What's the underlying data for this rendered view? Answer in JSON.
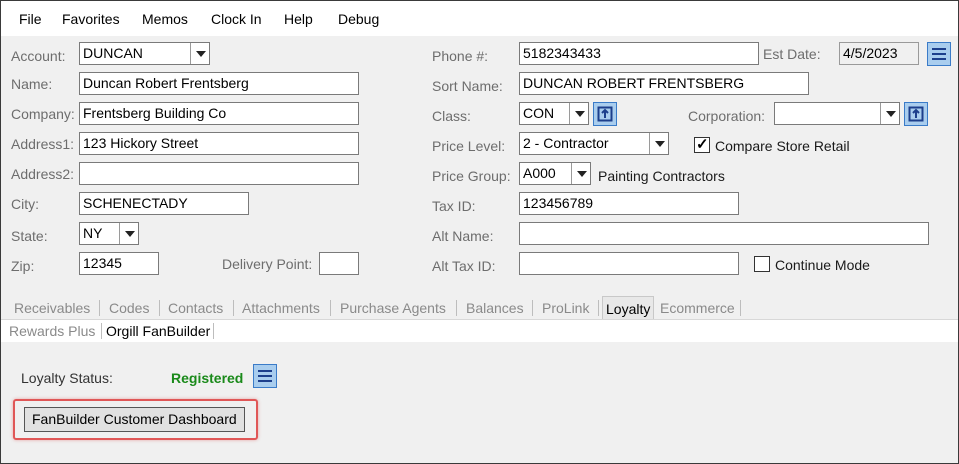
{
  "menu": [
    "File",
    "Favorites",
    "Memos",
    "Clock In",
    "Help",
    "Debug"
  ],
  "left": {
    "account_label": "Account:",
    "account_value": "DUNCAN",
    "name_label": "Name:",
    "name_value": "Duncan Robert Frentsberg",
    "company_label": "Company:",
    "company_value": "Frentsberg Building Co",
    "address1_label": "Address1:",
    "address1_value": "123 Hickory Street",
    "address2_label": "Address2:",
    "address2_value": "",
    "city_label": "City:",
    "city_value": "SCHENECTADY",
    "state_label": "State:",
    "state_value": "NY",
    "zip_label": "Zip:",
    "zip_value": "12345",
    "delivery_label": "Delivery Point:",
    "delivery_value": ""
  },
  "right": {
    "phone_label": "Phone #:",
    "phone_value": "5182343433",
    "estdate_label": "Est Date:",
    "estdate_value": "4/5/2023",
    "sortname_label": "Sort Name:",
    "sortname_value": "DUNCAN ROBERT FRENTSBERG",
    "class_label": "Class:",
    "class_value": "CON",
    "corporation_label": "Corporation:",
    "corporation_value": "",
    "pricelevel_label": "Price Level:",
    "pricelevel_value": "2 - Contractor",
    "compare_label": "Compare Store Retail",
    "compare_checked": true,
    "pricegroup_label": "Price Group:",
    "pricegroup_value": "A000",
    "pricegroup_desc": "Painting Contractors",
    "taxid_label": "Tax ID:",
    "taxid_value": "123456789",
    "altname_label": "Alt  Name:",
    "altname_value": "",
    "alttaxid_label": "Alt Tax ID:",
    "alttaxid_value": "",
    "continue_label": "Continue Mode",
    "continue_checked": false
  },
  "tabs": [
    "Receivables",
    "Codes",
    "Contacts",
    "Attachments",
    "Purchase Agents",
    "Balances",
    "ProLink",
    "Loyalty",
    "Ecommerce"
  ],
  "active_tab": "Loyalty",
  "subtabs": [
    "Rewards Plus",
    "Orgill FanBuilder"
  ],
  "active_subtab": "Orgill FanBuilder",
  "loyalty": {
    "status_label": "Loyalty Status:",
    "status_value": "Registered",
    "dashboard_button": "FanBuilder Customer Dashboard"
  },
  "colors": {
    "status_green": "#1a8a1a",
    "icon_blue": "#a9cdee",
    "highlight_red": "#e05757"
  },
  "icons": [
    "list-icon",
    "lookup-icon",
    "dropdown-arrow-icon"
  ]
}
